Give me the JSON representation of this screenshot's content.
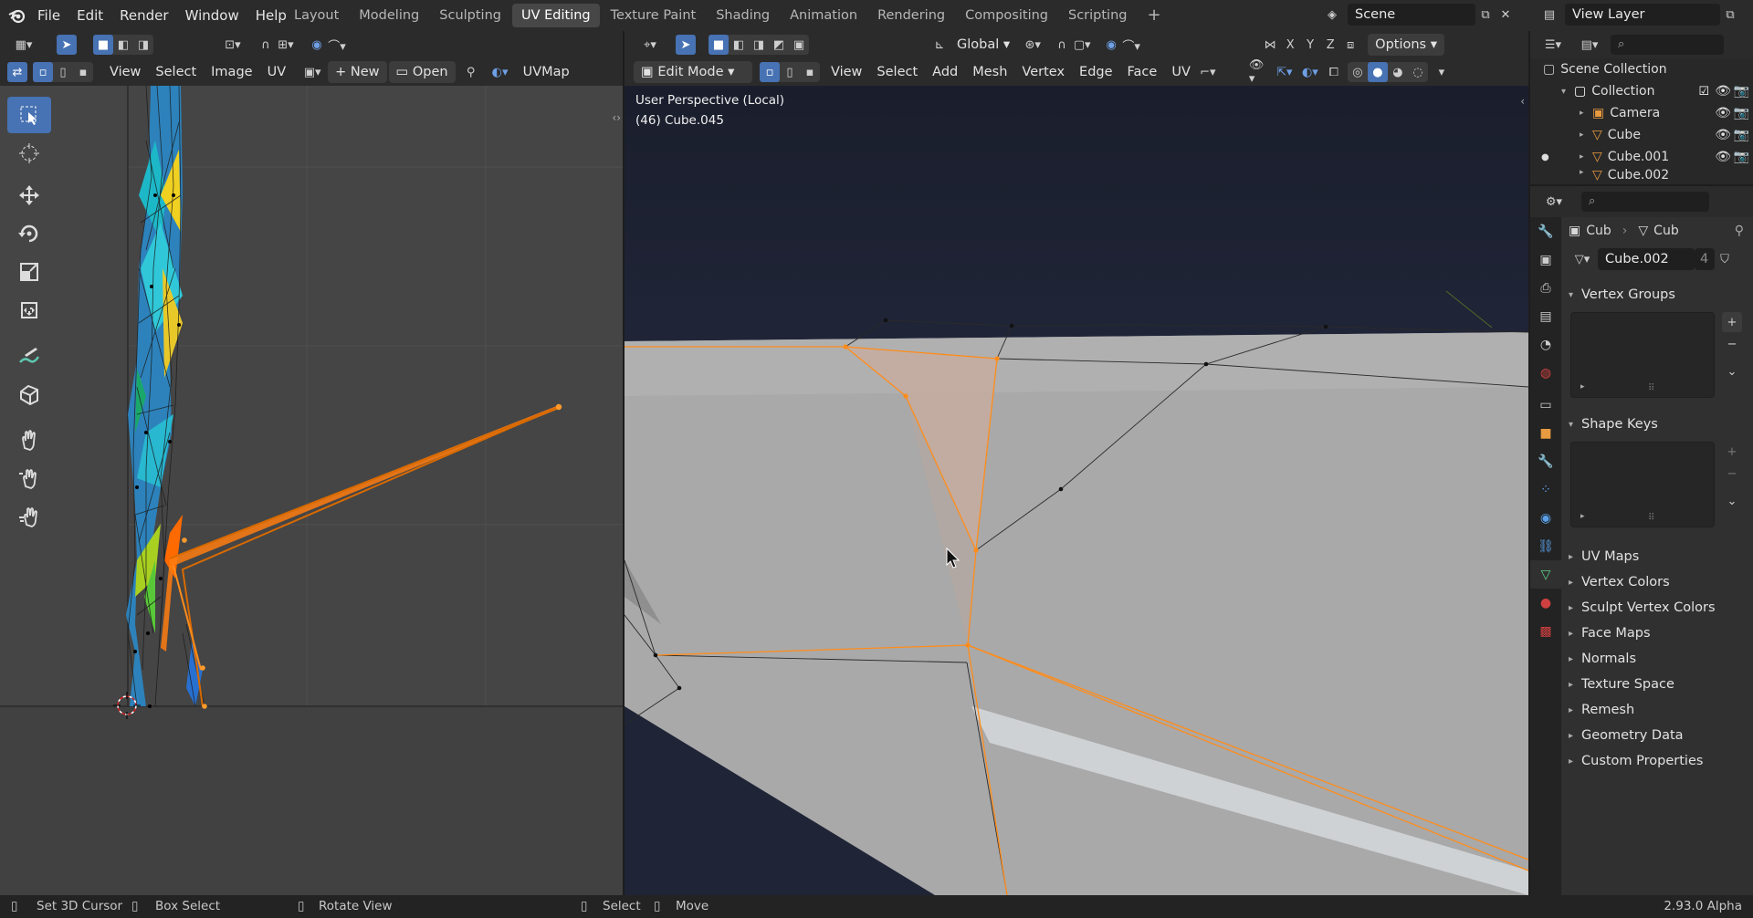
{
  "topbar": {
    "menus": [
      "File",
      "Edit",
      "Render",
      "Window",
      "Help"
    ],
    "workspaces": [
      "Layout",
      "Modeling",
      "Sculpting",
      "UV Editing",
      "Texture Paint",
      "Shading",
      "Animation",
      "Rendering",
      "Compositing",
      "Scripting"
    ],
    "active_workspace": "UV Editing",
    "scene": "Scene",
    "view_layer": "View Layer"
  },
  "uv_editor": {
    "menus": [
      "View",
      "Select",
      "Image",
      "UV"
    ],
    "new_label": "New",
    "open_label": "Open",
    "uvmap_label": "UVMap"
  },
  "viewport": {
    "orientation": "Global",
    "options_label": "Options",
    "mode": "Edit Mode",
    "menus": [
      "View",
      "Select",
      "Add",
      "Mesh",
      "Vertex",
      "Edge",
      "Face",
      "UV"
    ],
    "axes": [
      "X",
      "Y",
      "Z"
    ],
    "perspective": "User Perspective (Local)",
    "object_info": "(46) Cube.045"
  },
  "outliner": {
    "title": "Scene Collection",
    "items": [
      {
        "name": "Collection",
        "type": "collection"
      },
      {
        "name": "Camera",
        "type": "camera"
      },
      {
        "name": "Cube",
        "type": "mesh"
      },
      {
        "name": "Cube.001",
        "type": "mesh"
      },
      {
        "name": "Cube.002",
        "type": "mesh"
      }
    ]
  },
  "properties": {
    "breadcrumb_object": "Cub",
    "breadcrumb_mesh": "Cub",
    "mesh_name": "Cube.002",
    "user_count": "4",
    "panels_open": [
      "Vertex Groups",
      "Shape Keys"
    ],
    "panels_closed": [
      "UV Maps",
      "Vertex Colors",
      "Sculpt Vertex Colors",
      "Face Maps",
      "Normals",
      "Texture Space",
      "Remesh",
      "Geometry Data",
      "Custom Properties"
    ]
  },
  "statusbar": {
    "items": [
      "Set 3D Cursor",
      "Box Select",
      "Rotate View",
      "Select",
      "Move"
    ],
    "version": "2.93.0 Alpha"
  },
  "colors": {
    "accent": "#4772b3",
    "selection": "#ff8c1a",
    "mesh_surface": "#a9a9a9"
  }
}
